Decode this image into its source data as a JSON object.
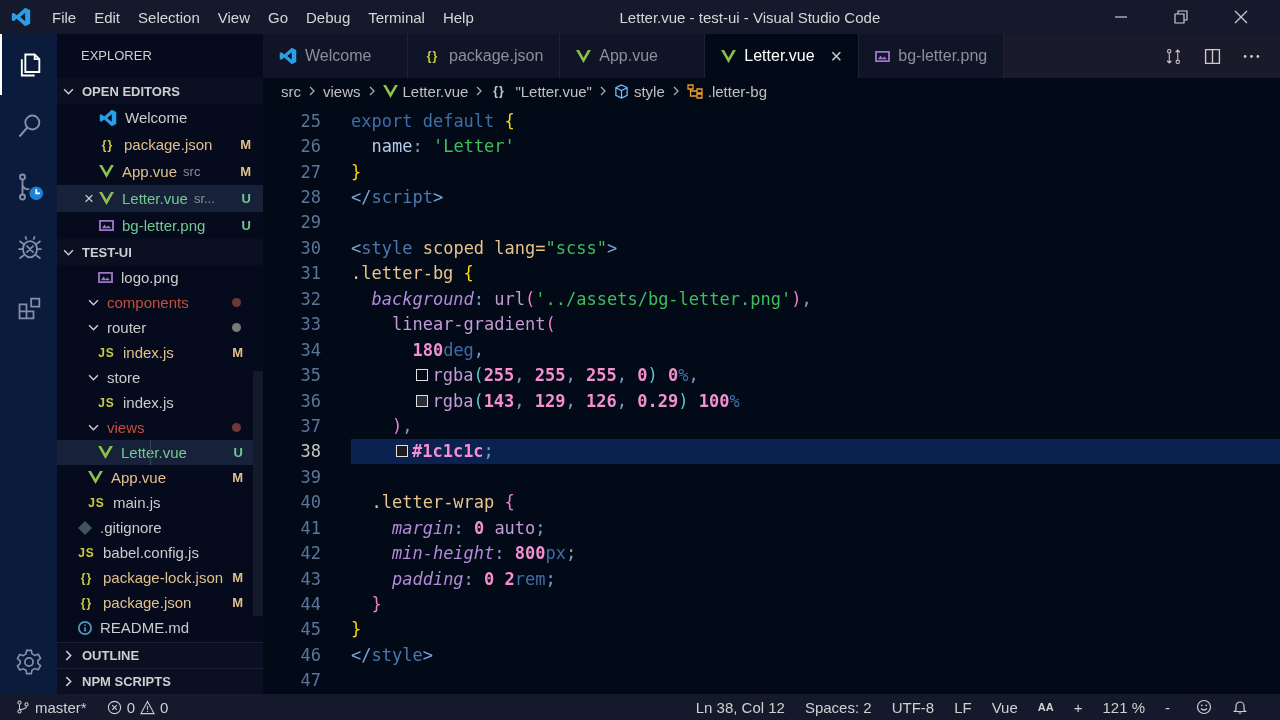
{
  "window": {
    "title": "Letter.vue - test-ui - Visual Studio Code"
  },
  "menu": [
    "File",
    "Edit",
    "Selection",
    "View",
    "Go",
    "Debug",
    "Terminal",
    "Help"
  ],
  "activity_bar": [
    {
      "kind": "explorer",
      "selected": true
    },
    {
      "kind": "search",
      "selected": false
    },
    {
      "kind": "source-control",
      "selected": false
    },
    {
      "kind": "debug",
      "selected": false
    },
    {
      "kind": "extensions",
      "selected": false
    }
  ],
  "explorer": {
    "title": "EXPLORER",
    "open_editors": {
      "title": "OPEN EDITORS",
      "expanded": true,
      "items": [
        {
          "name": "Welcome",
          "kind": "vscode",
          "selected": false
        },
        {
          "name": "package.json",
          "kind": "json",
          "glyph": "{}",
          "badge": "M",
          "selected": false
        },
        {
          "name": "App.vue",
          "kind": "vue",
          "detail": "src",
          "badge": "M",
          "selected": false
        },
        {
          "name": "Letter.vue",
          "kind": "vue",
          "detail": "sr...",
          "badge": "U",
          "selected": true,
          "close": "×"
        },
        {
          "name": "bg-letter.png",
          "kind": "image",
          "badge": "U",
          "selected": false
        }
      ]
    },
    "project": {
      "title": "TEST-UI",
      "expanded": true,
      "children": [
        {
          "children": [
            {
              "children": [
                {
                  "name": "logo.png",
                  "kind": "image",
                  "selected": false
                }
              ]
            },
            {
              "name": "components",
              "kind": "folder",
              "expanded": true,
              "problem": true,
              "color": "#6e3838",
              "selected": false
            },
            {
              "name": "router",
              "kind": "folder",
              "expanded": true,
              "problem": false,
              "color": "#7a7a7a",
              "selected": false,
              "children": [
                {
                  "name": "index.js",
                  "kind": "js",
                  "glyph": "JS",
                  "badge": "M",
                  "selected": false
                }
              ]
            },
            {
              "name": "store",
              "kind": "folder",
              "expanded": true,
              "problem": false,
              "selected": false,
              "children": [
                {
                  "name": "index.js",
                  "kind": "js",
                  "glyph": "JS",
                  "selected": false
                }
              ]
            },
            {
              "name": "views",
              "kind": "folder",
              "expanded": true,
              "problem": true,
              "color": "#6e3838",
              "selected": false,
              "children": [
                {
                  "name": "Letter.vue",
                  "kind": "vue",
                  "badge": "U",
                  "selected": true
                }
              ]
            },
            {
              "name": "App.vue",
              "kind": "vue",
              "badge": "M",
              "selected": false
            },
            {
              "name": "main.js",
              "kind": "js",
              "glyph": "JS",
              "selected": false
            }
          ]
        },
        {
          "name": ".gitignore",
          "kind": "git",
          "selected": false
        },
        {
          "name": "babel.config.js",
          "kind": "js",
          "glyph": "JS",
          "selected": false
        },
        {
          "name": "package-lock.json",
          "kind": "json",
          "glyph": "{}",
          "badge": "M",
          "selected": false
        },
        {
          "name": "package.json",
          "kind": "json",
          "glyph": "{}",
          "badge": "M",
          "selected": false
        },
        {
          "name": "README.md",
          "kind": "info",
          "selected": false
        }
      ]
    },
    "sections": [
      {
        "title": "OUTLINE",
        "expanded": false
      },
      {
        "title": "NPM SCRIPTS",
        "expanded": false
      }
    ]
  },
  "tabs": [
    {
      "label": "Welcome",
      "kind": "vscode",
      "selected": false
    },
    {
      "label": "package.json",
      "kind": "json",
      "glyph": "{}",
      "selected": false
    },
    {
      "label": "App.vue",
      "kind": "vue",
      "selected": false
    },
    {
      "label": "Letter.vue",
      "kind": "vue",
      "selected": true,
      "close": "×"
    },
    {
      "label": "bg-letter.png",
      "kind": "image",
      "selected": false
    }
  ],
  "breadcrumbs": [
    {
      "label": "src",
      "kind": "none"
    },
    {
      "label": "views",
      "kind": "none"
    },
    {
      "label": "Letter.vue",
      "kind": "vue"
    },
    {
      "label": "\"Letter.vue\"",
      "kind": "json",
      "glyph": "{}"
    },
    {
      "label": "style",
      "kind": "cube"
    },
    {
      "label": ".letter-bg",
      "kind": "selector"
    }
  ],
  "code": {
    "lines": [
      {
        "n": "25",
        "selected": false,
        "text": "export default {"
      },
      {
        "n": "26",
        "selected": false,
        "text": "  name: 'Letter'"
      },
      {
        "n": "27",
        "selected": false,
        "text": "}"
      },
      {
        "n": "28",
        "selected": false,
        "text": "</script>"
      },
      {
        "n": "29",
        "selected": false
      },
      {
        "n": "30",
        "selected": false,
        "text": "<style scoped lang=\"scss\">"
      },
      {
        "n": "31",
        "selected": false,
        "text": ".letter-bg {"
      },
      {
        "n": "32",
        "selected": false,
        "text": "  background: url('../assets/bg-letter.png'),"
      },
      {
        "n": "33",
        "selected": false,
        "text": "    linear-gradient("
      },
      {
        "n": "34",
        "selected": false,
        "text": "      180deg,"
      },
      {
        "n": "35",
        "selected": false,
        "text": "      rgba(255, 255, 255, 0) 0%,"
      },
      {
        "n": "36",
        "selected": false,
        "text": "      rgba(143, 129, 126, 0.29) 100%"
      },
      {
        "n": "37",
        "selected": false,
        "text": "    ),"
      },
      {
        "n": "38",
        "selected": true,
        "text": "    #1c1c1c;"
      },
      {
        "n": "39",
        "selected": false
      },
      {
        "n": "40",
        "selected": false,
        "text": "  .letter-wrap {"
      },
      {
        "n": "41",
        "selected": false,
        "text": "    margin: 0 auto;"
      },
      {
        "n": "42",
        "selected": false,
        "text": "    min-height: 800px;"
      },
      {
        "n": "43",
        "selected": false,
        "text": "    padding: 0 2rem;"
      },
      {
        "n": "44",
        "selected": false,
        "text": "  }"
      },
      {
        "n": "45",
        "selected": false,
        "text": "}"
      },
      {
        "n": "46",
        "selected": false,
        "text": "</style>"
      },
      {
        "n": "47",
        "selected": false
      }
    ]
  },
  "status_bar": {
    "branch": "master*",
    "errors": "0",
    "warnings": "0",
    "right": [
      {
        "kind": "text",
        "label": "Ln 38, Col 12"
      },
      {
        "kind": "text",
        "label": "Spaces: 2"
      },
      {
        "kind": "text",
        "label": "UTF-8"
      },
      {
        "kind": "text",
        "label": "LF"
      },
      {
        "kind": "text",
        "label": "Vue"
      },
      {
        "kind": "small",
        "label": "AA"
      },
      {
        "kind": "text",
        "label": "+"
      },
      {
        "kind": "text",
        "label": "121 %"
      },
      {
        "kind": "text",
        "label": "-"
      },
      {
        "kind": "smiley"
      },
      {
        "kind": "bell"
      }
    ]
  }
}
